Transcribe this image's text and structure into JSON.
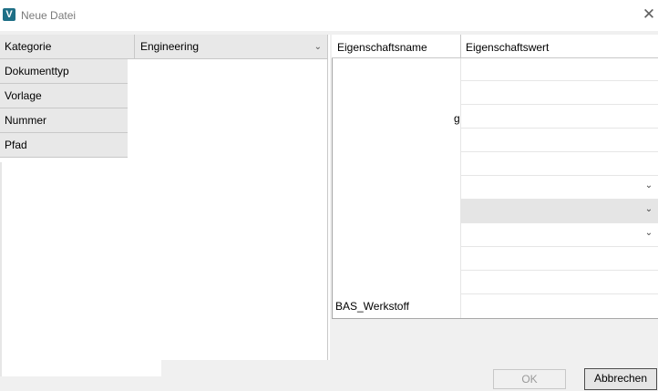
{
  "window": {
    "title": "Neue Datei",
    "logo_letter": "V"
  },
  "left_grid": {
    "category_label": "Kategorie",
    "category_value": "Engineering",
    "rows": [
      "Dokumenttyp",
      "Vorlage",
      "Nummer",
      "Pfad"
    ]
  },
  "property_grid": {
    "header_name": "Eigenschaftsname",
    "header_value": "Eigenschaftswert",
    "clipped_text": "g",
    "last_row_name": "BAS_Werkstoff"
  },
  "buttons": {
    "ok": "OK",
    "cancel": "Abbrechen"
  }
}
